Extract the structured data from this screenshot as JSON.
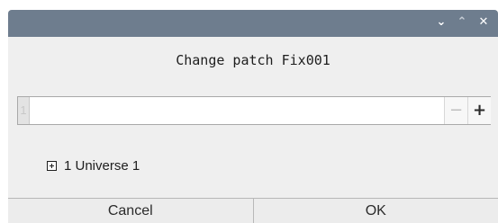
{
  "window": {
    "controls": {
      "minimize_icon": "chevron-down-icon",
      "maximize_icon": "chevron-up-icon",
      "close_icon": "close-icon"
    }
  },
  "dialog": {
    "title": "Change patch Fix001"
  },
  "address": {
    "indicator": "1",
    "value": "",
    "decrement": "−",
    "increment": "+"
  },
  "tree": {
    "items": [
      {
        "label": "1 Universe 1",
        "expanded": false
      }
    ]
  },
  "buttons": {
    "cancel": "Cancel",
    "ok": "OK"
  },
  "colors": {
    "titlebar": "#6e7d8e",
    "background": "#efefef"
  }
}
